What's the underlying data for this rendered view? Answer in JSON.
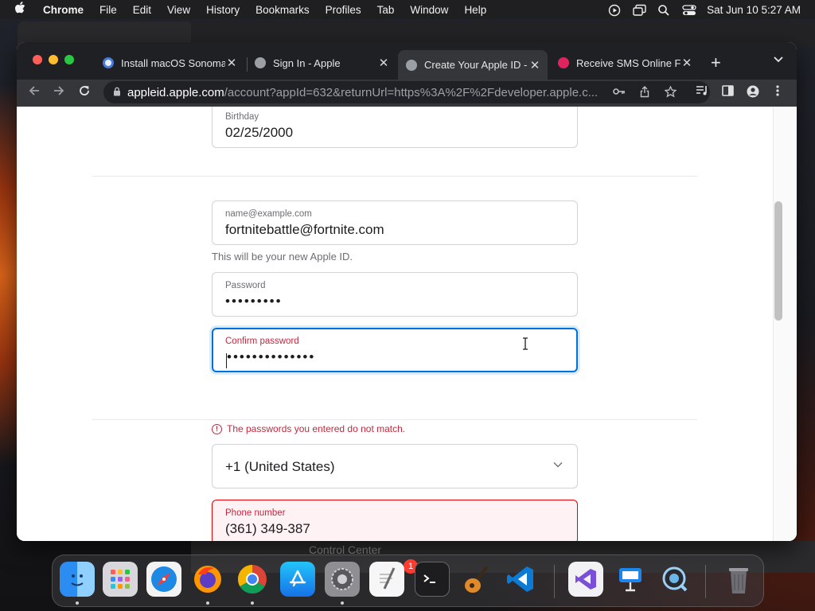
{
  "menubar": {
    "app_name": "Chrome",
    "items": [
      "File",
      "Edit",
      "View",
      "History",
      "Bookmarks",
      "Profiles",
      "Tab",
      "Window",
      "Help"
    ],
    "clock": "Sat Jun 10  5:27 AM"
  },
  "background": {
    "control_center_label": "Control Center"
  },
  "browser": {
    "tabs": [
      {
        "title": "Install macOS Sonoma",
        "favicon_color": "#e8f0fe"
      },
      {
        "title": "Sign In - Apple",
        "favicon_color": "#9aa0a6"
      },
      {
        "title": "Create Your Apple ID -",
        "favicon_color": "#9aa0a6"
      },
      {
        "title": "Receive SMS Online F",
        "favicon_color": "#e0245e"
      }
    ],
    "url_host": "appleid.apple.com",
    "url_path": "/account?appId=632&returnUrl=https%3A%2F%2Fdeveloper.apple.c..."
  },
  "form": {
    "birthday_label": "Birthday",
    "birthday_value": "02/25/2000",
    "email_label": "name@example.com",
    "email_value": "fortnitebattle@fortnite.com",
    "email_hint": "This will be your new Apple ID.",
    "password_label": "Password",
    "password_dots": "•••••••••",
    "confirm_label": "Confirm password",
    "confirm_dots": "••••••••••••••",
    "error_message": "The passwords you entered do not match.",
    "country_code_value": "+1 (United States)",
    "phone_label": "Phone number",
    "phone_value": "(361) 349-387"
  },
  "dock": {
    "settings_badge": "1",
    "apps": [
      "finder",
      "launchpad",
      "safari",
      "firefox",
      "chrome",
      "app-store",
      "system-settings",
      "textedit",
      "terminal",
      "garageband",
      "vscode",
      "visual-studio",
      "keynote",
      "quicktime",
      "trash"
    ]
  },
  "colors": {
    "accent": "#0071e3",
    "error": "#c4283e"
  }
}
